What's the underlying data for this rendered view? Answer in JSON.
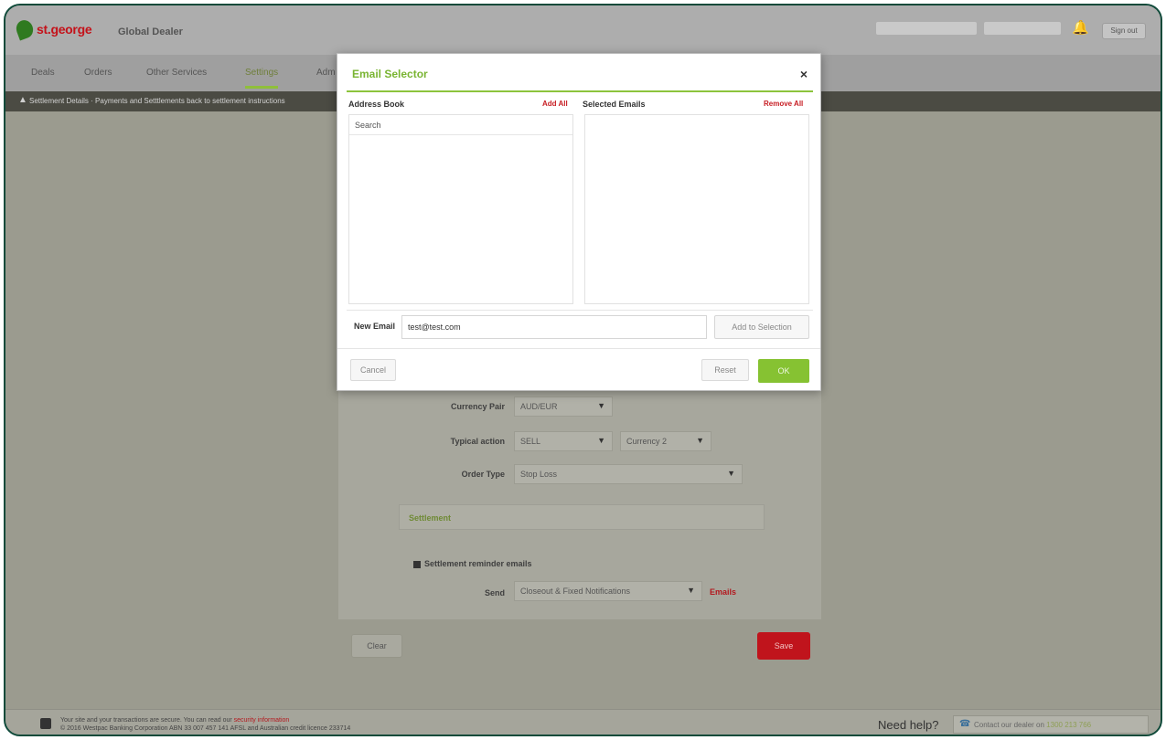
{
  "header": {
    "brand": "st.george",
    "app_title": "Global Dealer",
    "signout_label": "Sign out"
  },
  "nav": {
    "items": [
      "Deals",
      "Orders",
      "Other Services",
      "Settings",
      "Adm"
    ]
  },
  "breadcrumb": {
    "text": "Settlement Details · Payments and Setttlements back to settlement instructions"
  },
  "form": {
    "currency_pair_label": "Currency Pair",
    "currency_pair_value": "AUD/EUR",
    "typical_action_label": "Typical action",
    "typical_action_value": "SELL",
    "currency_value": "Currency 2",
    "order_type_label": "Order Type",
    "order_type_value": "Stop Loss",
    "settlement_heading": "Settlement",
    "settlement_check_label": "Settlement reminder emails",
    "send_label": "Send",
    "send_value": "Closeout & Fixed Notifications",
    "emails_link": "Emails",
    "clear_label": "Clear",
    "save_label": "Save"
  },
  "modal": {
    "title": "Email Selector",
    "close_glyph": "×",
    "address_book_label": "Address Book",
    "add_all_label": "Add All",
    "selected_emails_label": "Selected Emails",
    "remove_all_label": "Remove All",
    "search_label": "Search",
    "new_email_label": "New Email",
    "new_email_value": "test@test.com",
    "add_to_selection_label": "Add to Selection",
    "cancel_label": "Cancel",
    "reset_label": "Reset",
    "ok_label": "OK"
  },
  "footer": {
    "line1_prefix": "Your site and your transactions are secure. You can read our ",
    "line1_link": "security information",
    "line2": "© 2016 Westpac Banking Corporation ABN 33 007 457 141 AFSL and Australian credit licence 233714",
    "need_help": "Need help?",
    "phone_label": "Contact our dealer on ",
    "phone_number": "1300 213 766"
  },
  "icons": {
    "bell": "bell-icon",
    "lock": "lock-icon",
    "phone": "phone-icon",
    "home": "home-icon"
  },
  "colors": {
    "brand_red": "#c4121a",
    "accent_green": "#86c232",
    "title_green": "#79b432",
    "frame": "#0f4a3a"
  }
}
